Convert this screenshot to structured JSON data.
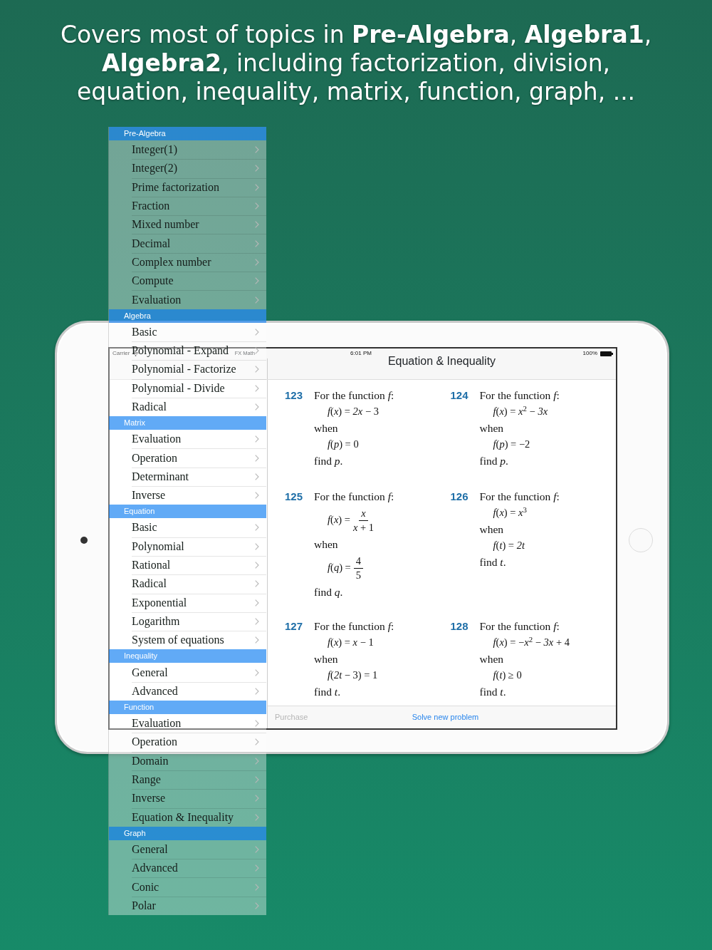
{
  "headline": "Covers most of topics in **Pre-Algebra**, **Algebra1**, **Algebra2**, including factorization, division, equation, inequality, matrix, function, graph, ...",
  "status_bar": {
    "carrier": "Carrier",
    "time": "6:01 PM",
    "battery": "100%"
  },
  "master": {
    "title": "FX Math"
  },
  "detail": {
    "title": "Equation & Inequality",
    "problems": [
      {
        "number": "123",
        "lines": [
          {
            "kind": "text",
            "text": "For the function *f*:"
          },
          {
            "kind": "formula",
            "text": "*f*(*x*) = *2x* − 3"
          },
          {
            "kind": "text",
            "text": "when"
          },
          {
            "kind": "formula",
            "text": "*f*(*p*) = 0"
          },
          {
            "kind": "text",
            "text": "find *p*."
          }
        ]
      },
      {
        "number": "124",
        "lines": [
          {
            "kind": "text",
            "text": "For the function *f*:"
          },
          {
            "kind": "formula",
            "text": "*f*(*x*) = *x*$^{2}$ − *3x*"
          },
          {
            "kind": "text",
            "text": "when"
          },
          {
            "kind": "formula",
            "text": "*f*(*p*) = −2"
          },
          {
            "kind": "text",
            "text": "find *p*."
          }
        ]
      },
      {
        "number": "125",
        "lines": [
          {
            "kind": "text",
            "text": "For the function *f*:"
          },
          {
            "kind": "fraction",
            "lhs": "*f*(*x*) =",
            "num": "*x*",
            "den": "*x* + 1"
          },
          {
            "kind": "text",
            "text": "when"
          },
          {
            "kind": "fraction",
            "lhs": "*f*(*q*) =",
            "num": "4",
            "den": "5"
          },
          {
            "kind": "text",
            "text": "find *q*."
          }
        ]
      },
      {
        "number": "126",
        "lines": [
          {
            "kind": "text",
            "text": "For the function *f*:"
          },
          {
            "kind": "formula",
            "text": "*f*(*x*) = *x*$^{3}$"
          },
          {
            "kind": "text",
            "text": "when"
          },
          {
            "kind": "formula",
            "text": "*f*(*t*) = *2t*"
          },
          {
            "kind": "text",
            "text": "find *t*."
          }
        ]
      },
      {
        "number": "127",
        "lines": [
          {
            "kind": "text",
            "text": "For the function *f*:"
          },
          {
            "kind": "formula",
            "text": "*f*(*x*) = *x* − 1"
          },
          {
            "kind": "text",
            "text": "when"
          },
          {
            "kind": "formula",
            "text": "*f*(*2t* − 3) = 1"
          },
          {
            "kind": "text",
            "text": "find *t*."
          }
        ]
      },
      {
        "number": "128",
        "lines": [
          {
            "kind": "text",
            "text": "For the function *f*:"
          },
          {
            "kind": "formula",
            "text": "*f*(*x*) = −*x*$^{2}$ − *3x* + 4"
          },
          {
            "kind": "text",
            "text": "when"
          },
          {
            "kind": "formula",
            "text": "*f*(*t*) ≥ 0"
          },
          {
            "kind": "text",
            "text": "find *t*."
          }
        ]
      }
    ]
  },
  "toolbar": [
    {
      "label": "Purchase",
      "disabled": true
    },
    {
      "label": "Solve new problem",
      "disabled": false
    }
  ],
  "menu": [
    {
      "title": "Pre-Algebra",
      "items": [
        "Integer(1)",
        "Integer(2)",
        "Prime factorization",
        "Fraction",
        "Mixed number",
        "Decimal",
        "Complex number",
        "Compute",
        "Evaluation"
      ]
    },
    {
      "title": "Algebra",
      "items": [
        "Basic",
        "Polynomial - Expand",
        "Polynomial - Factorize",
        "Polynomial - Divide",
        "Radical"
      ]
    },
    {
      "title": "Matrix",
      "items": [
        "Evaluation",
        "Operation",
        "Determinant",
        "Inverse"
      ]
    },
    {
      "title": "Equation",
      "items": [
        "Basic",
        "Polynomial",
        "Rational",
        "Radical",
        "Exponential",
        "Logarithm",
        "System of equations"
      ]
    },
    {
      "title": "Inequality",
      "items": [
        "General",
        "Advanced"
      ]
    },
    {
      "title": "Function",
      "items": [
        "Evaluation",
        "Operation",
        "Domain",
        "Range",
        "Inverse",
        "Equation & Inequality"
      ]
    },
    {
      "title": "Graph",
      "items": [
        "General",
        "Advanced",
        "Conic",
        "Polar"
      ]
    }
  ]
}
